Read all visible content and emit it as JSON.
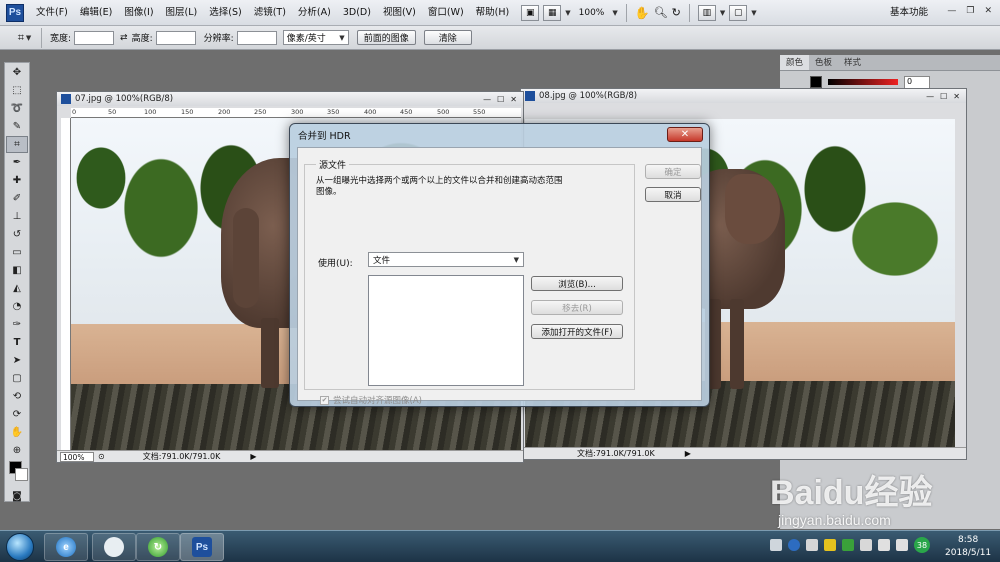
{
  "app": {
    "logo_text": "Ps",
    "menu": [
      "文件(F)",
      "编辑(E)",
      "图像(I)",
      "图层(L)",
      "选择(S)",
      "滤镜(T)",
      "分析(A)",
      "3D(D)",
      "视图(V)",
      "窗口(W)",
      "帮助(H)"
    ],
    "zoom_level": "100%",
    "workspace": "基本功能"
  },
  "options_bar": {
    "width_label": "宽度:",
    "height_label": "高度:",
    "resolution_label": "分辨率:",
    "unit_select": "像素/英寸",
    "front_image_button": "前面的图像",
    "clear_button": "清除"
  },
  "right_panel": {
    "tabs": [
      "颜色",
      "色板",
      "样式"
    ],
    "value": "0"
  },
  "doc_left": {
    "title": "07.jpg @ 100%(RGB/8)",
    "ruler_ticks": [
      "0",
      "50",
      "100",
      "150",
      "200",
      "250",
      "300",
      "350",
      "400",
      "450",
      "500",
      "550"
    ],
    "zoom": "100%",
    "doc_size": "文档:791.0K/791.0K"
  },
  "doc_right": {
    "title": "08.jpg @ 100%(RGB/8)",
    "doc_size": "文档:791.0K/791.0K"
  },
  "hdr_dialog": {
    "title": "合并到 HDR",
    "group_title": "源文件",
    "description": "从一组曝光中选择两个或两个以上的文件以合并和创建高动态范围图像。",
    "use_label": "使用(U):",
    "use_value": "文件",
    "browse_button": "浏览(B)...",
    "remove_button": "移去(R)",
    "add_open_button": "添加打开的文件(F)",
    "ok_button": "确定",
    "cancel_button": "取消",
    "auto_align_label": "尝试自动对齐源图像(A)",
    "auto_align_checked": true
  },
  "taskbar": {
    "ps_label": "Ps",
    "tray_badge": "38",
    "time": "8:58",
    "date": "2018/5/11"
  },
  "watermark": {
    "logo": "Baidu经验",
    "url": "jingyan.baidu.com"
  }
}
